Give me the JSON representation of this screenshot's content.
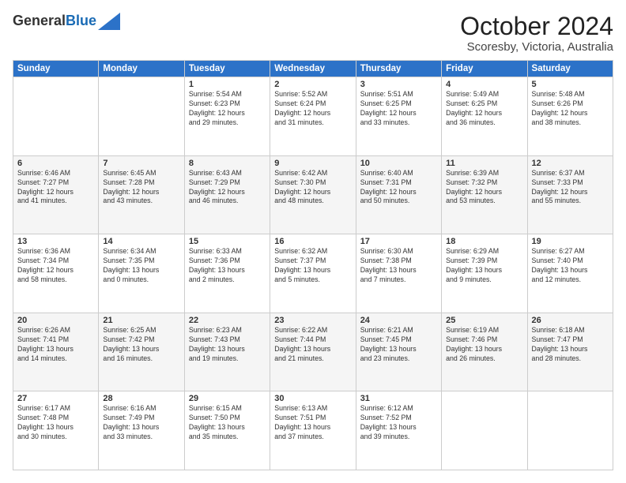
{
  "header": {
    "logo_line1": "General",
    "logo_line2": "Blue",
    "month_year": "October 2024",
    "location": "Scoresby, Victoria, Australia"
  },
  "weekdays": [
    "Sunday",
    "Monday",
    "Tuesday",
    "Wednesday",
    "Thursday",
    "Friday",
    "Saturday"
  ],
  "weeks": [
    [
      {
        "day": "",
        "text": ""
      },
      {
        "day": "",
        "text": ""
      },
      {
        "day": "1",
        "text": "Sunrise: 5:54 AM\nSunset: 6:23 PM\nDaylight: 12 hours\nand 29 minutes."
      },
      {
        "day": "2",
        "text": "Sunrise: 5:52 AM\nSunset: 6:24 PM\nDaylight: 12 hours\nand 31 minutes."
      },
      {
        "day": "3",
        "text": "Sunrise: 5:51 AM\nSunset: 6:25 PM\nDaylight: 12 hours\nand 33 minutes."
      },
      {
        "day": "4",
        "text": "Sunrise: 5:49 AM\nSunset: 6:25 PM\nDaylight: 12 hours\nand 36 minutes."
      },
      {
        "day": "5",
        "text": "Sunrise: 5:48 AM\nSunset: 6:26 PM\nDaylight: 12 hours\nand 38 minutes."
      }
    ],
    [
      {
        "day": "6",
        "text": "Sunrise: 6:46 AM\nSunset: 7:27 PM\nDaylight: 12 hours\nand 41 minutes."
      },
      {
        "day": "7",
        "text": "Sunrise: 6:45 AM\nSunset: 7:28 PM\nDaylight: 12 hours\nand 43 minutes."
      },
      {
        "day": "8",
        "text": "Sunrise: 6:43 AM\nSunset: 7:29 PM\nDaylight: 12 hours\nand 46 minutes."
      },
      {
        "day": "9",
        "text": "Sunrise: 6:42 AM\nSunset: 7:30 PM\nDaylight: 12 hours\nand 48 minutes."
      },
      {
        "day": "10",
        "text": "Sunrise: 6:40 AM\nSunset: 7:31 PM\nDaylight: 12 hours\nand 50 minutes."
      },
      {
        "day": "11",
        "text": "Sunrise: 6:39 AM\nSunset: 7:32 PM\nDaylight: 12 hours\nand 53 minutes."
      },
      {
        "day": "12",
        "text": "Sunrise: 6:37 AM\nSunset: 7:33 PM\nDaylight: 12 hours\nand 55 minutes."
      }
    ],
    [
      {
        "day": "13",
        "text": "Sunrise: 6:36 AM\nSunset: 7:34 PM\nDaylight: 12 hours\nand 58 minutes."
      },
      {
        "day": "14",
        "text": "Sunrise: 6:34 AM\nSunset: 7:35 PM\nDaylight: 13 hours\nand 0 minutes."
      },
      {
        "day": "15",
        "text": "Sunrise: 6:33 AM\nSunset: 7:36 PM\nDaylight: 13 hours\nand 2 minutes."
      },
      {
        "day": "16",
        "text": "Sunrise: 6:32 AM\nSunset: 7:37 PM\nDaylight: 13 hours\nand 5 minutes."
      },
      {
        "day": "17",
        "text": "Sunrise: 6:30 AM\nSunset: 7:38 PM\nDaylight: 13 hours\nand 7 minutes."
      },
      {
        "day": "18",
        "text": "Sunrise: 6:29 AM\nSunset: 7:39 PM\nDaylight: 13 hours\nand 9 minutes."
      },
      {
        "day": "19",
        "text": "Sunrise: 6:27 AM\nSunset: 7:40 PM\nDaylight: 13 hours\nand 12 minutes."
      }
    ],
    [
      {
        "day": "20",
        "text": "Sunrise: 6:26 AM\nSunset: 7:41 PM\nDaylight: 13 hours\nand 14 minutes."
      },
      {
        "day": "21",
        "text": "Sunrise: 6:25 AM\nSunset: 7:42 PM\nDaylight: 13 hours\nand 16 minutes."
      },
      {
        "day": "22",
        "text": "Sunrise: 6:23 AM\nSunset: 7:43 PM\nDaylight: 13 hours\nand 19 minutes."
      },
      {
        "day": "23",
        "text": "Sunrise: 6:22 AM\nSunset: 7:44 PM\nDaylight: 13 hours\nand 21 minutes."
      },
      {
        "day": "24",
        "text": "Sunrise: 6:21 AM\nSunset: 7:45 PM\nDaylight: 13 hours\nand 23 minutes."
      },
      {
        "day": "25",
        "text": "Sunrise: 6:19 AM\nSunset: 7:46 PM\nDaylight: 13 hours\nand 26 minutes."
      },
      {
        "day": "26",
        "text": "Sunrise: 6:18 AM\nSunset: 7:47 PM\nDaylight: 13 hours\nand 28 minutes."
      }
    ],
    [
      {
        "day": "27",
        "text": "Sunrise: 6:17 AM\nSunset: 7:48 PM\nDaylight: 13 hours\nand 30 minutes."
      },
      {
        "day": "28",
        "text": "Sunrise: 6:16 AM\nSunset: 7:49 PM\nDaylight: 13 hours\nand 33 minutes."
      },
      {
        "day": "29",
        "text": "Sunrise: 6:15 AM\nSunset: 7:50 PM\nDaylight: 13 hours\nand 35 minutes."
      },
      {
        "day": "30",
        "text": "Sunrise: 6:13 AM\nSunset: 7:51 PM\nDaylight: 13 hours\nand 37 minutes."
      },
      {
        "day": "31",
        "text": "Sunrise: 6:12 AM\nSunset: 7:52 PM\nDaylight: 13 hours\nand 39 minutes."
      },
      {
        "day": "",
        "text": ""
      },
      {
        "day": "",
        "text": ""
      }
    ]
  ]
}
